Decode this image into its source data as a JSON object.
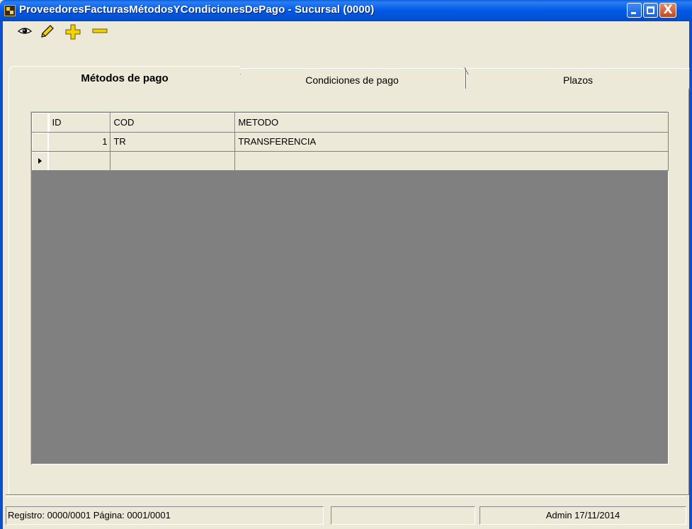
{
  "window": {
    "title": "ProveedoresFacturasMétodosYCondicionesDePago - Sucursal (0000)",
    "close_glyph": "X"
  },
  "toolbar": {
    "icons": [
      "eye-icon",
      "pencil-icon",
      "plus-icon",
      "minus-icon"
    ]
  },
  "tabs": [
    {
      "label": "Métodos de pago",
      "active": true
    },
    {
      "label": "Condiciones de pago",
      "active": false
    },
    {
      "label": "Plazos",
      "active": false
    }
  ],
  "grid": {
    "columns": [
      "ID",
      "COD",
      "METODO"
    ],
    "rows": [
      {
        "id": "1",
        "cod": "TR",
        "metodo": "TRANSFERENCIA"
      },
      {
        "id": "",
        "cod": "",
        "metodo": ""
      }
    ]
  },
  "statusbar": {
    "record_info": "Registro: 0000/0001  Página: 0001/0001",
    "middle": "",
    "user_date": "Admin 17/11/2014"
  },
  "colors": {
    "titlebar": "#0058e6",
    "face": "#ece9d8",
    "grid_bg": "#808080",
    "icon_yellow": "#f2d300"
  }
}
